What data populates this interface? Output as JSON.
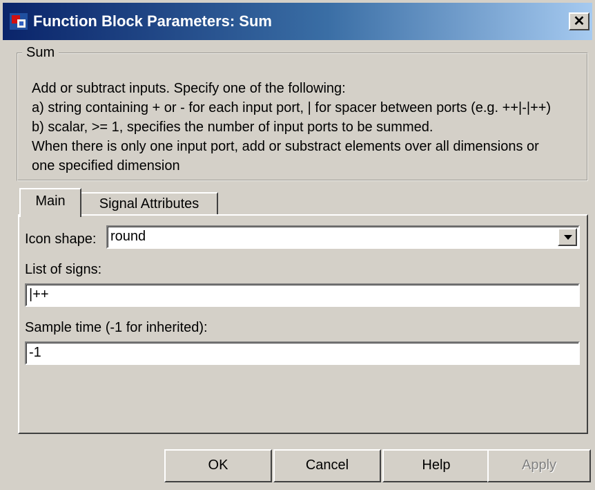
{
  "window": {
    "title": "Function Block Parameters: Sum",
    "close_glyph": "✕"
  },
  "group": {
    "legend": "Sum",
    "description": [
      "Add or subtract inputs.  Specify one of the following:",
      "a) string containing + or - for each input port, | for spacer between ports (e.g. ++|-|++)",
      "b) scalar, >= 1, specifies the number of input ports to be summed.",
      "When there is only one input port, add or substract elements over all dimensions or",
      "one specified dimension"
    ]
  },
  "tabs": [
    {
      "label": "Main",
      "active": true
    },
    {
      "label": "Signal Attributes",
      "active": false
    }
  ],
  "params": {
    "icon_shape_label": "Icon shape:",
    "icon_shape_value": "round",
    "list_of_signs_label": "List of signs:",
    "list_of_signs_value": "|++",
    "sample_time_label": "Sample time (-1 for inherited):",
    "sample_time_value": "-1"
  },
  "buttons": {
    "ok": "OK",
    "cancel": "Cancel",
    "help": "Help",
    "apply": "Apply"
  },
  "colors": {
    "titlebar_start": "#0a246a",
    "titlebar_end": "#a6caf0",
    "face": "#d4d0c8"
  }
}
